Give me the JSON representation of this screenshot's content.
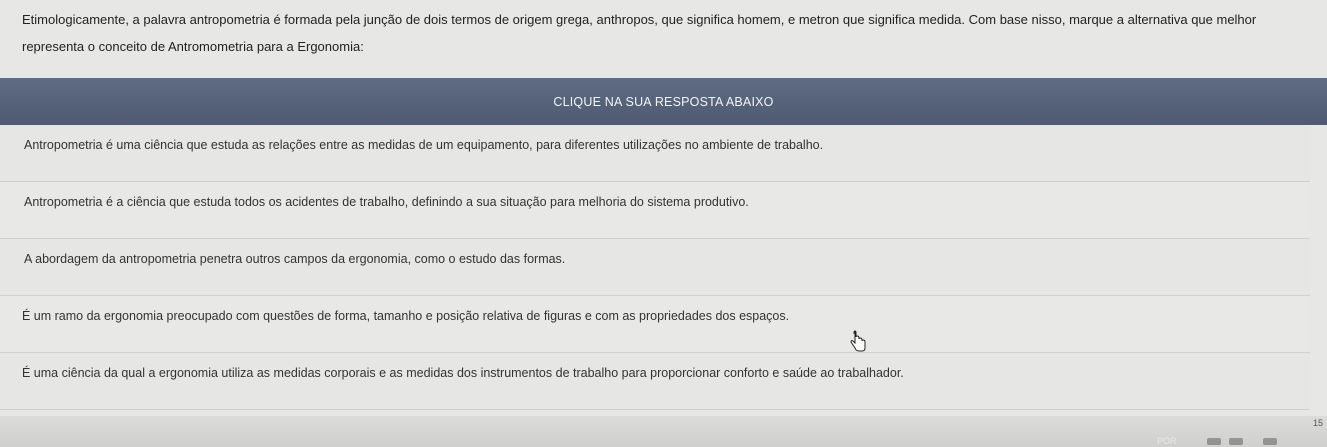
{
  "question": {
    "line1": "Etimologicamente, a palavra antropometria é formada pela junção de dois termos de origem grega, anthropos, que significa homem, e metron que significa medida. Com base nisso, marque a alternativa que melhor",
    "line2": "representa o conceito de Antromometria para a Ergonomia:"
  },
  "header": {
    "label": "CLIQUE NA SUA RESPOSTA ABAIXO"
  },
  "options": [
    "Antropometria é uma ciência que estuda as relações entre as medidas de um equipamento, para diferentes utilizações no ambiente de trabalho.",
    "Antropometria é a ciência que estuda todos os acidentes de trabalho, definindo a sua situação para melhoria do sistema produtivo.",
    "A abordagem da antropometria penetra outros campos da ergonomia, como o estudo das formas.",
    "É um ramo da ergonomia preocupado com questões de forma, tamanho e posição relativa de figuras e com as propriedades dos espaços.",
    "É uma ciência da qual a ergonomia utiliza as medidas corporais e as medidas dos instrumentos de trabalho para proporcionar conforto e saúde ao trabalhador."
  ],
  "taskbar": {
    "language": "POR",
    "clock": "15"
  },
  "colors": {
    "header_band": "#566279",
    "background": "#e7e7e5"
  }
}
